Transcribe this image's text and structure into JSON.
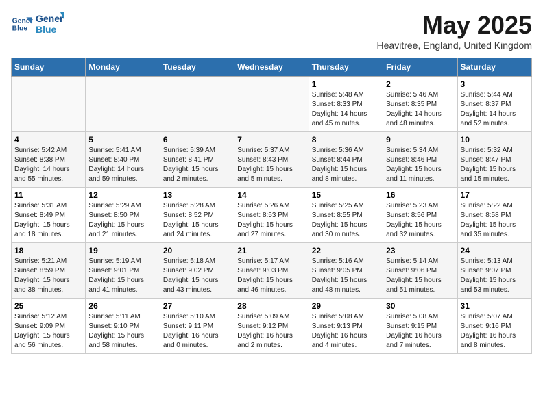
{
  "logo": {
    "line1": "General",
    "line2": "Blue"
  },
  "title": "May 2025",
  "location": "Heavitree, England, United Kingdom",
  "days_header": [
    "Sunday",
    "Monday",
    "Tuesday",
    "Wednesday",
    "Thursday",
    "Friday",
    "Saturday"
  ],
  "weeks": [
    [
      {
        "day": "",
        "sunrise": "",
        "sunset": "",
        "daylight": ""
      },
      {
        "day": "",
        "sunrise": "",
        "sunset": "",
        "daylight": ""
      },
      {
        "day": "",
        "sunrise": "",
        "sunset": "",
        "daylight": ""
      },
      {
        "day": "",
        "sunrise": "",
        "sunset": "",
        "daylight": ""
      },
      {
        "day": "1",
        "sunrise": "Sunrise: 5:48 AM",
        "sunset": "Sunset: 8:33 PM",
        "daylight": "Daylight: 14 hours and 45 minutes."
      },
      {
        "day": "2",
        "sunrise": "Sunrise: 5:46 AM",
        "sunset": "Sunset: 8:35 PM",
        "daylight": "Daylight: 14 hours and 48 minutes."
      },
      {
        "day": "3",
        "sunrise": "Sunrise: 5:44 AM",
        "sunset": "Sunset: 8:37 PM",
        "daylight": "Daylight: 14 hours and 52 minutes."
      }
    ],
    [
      {
        "day": "4",
        "sunrise": "Sunrise: 5:42 AM",
        "sunset": "Sunset: 8:38 PM",
        "daylight": "Daylight: 14 hours and 55 minutes."
      },
      {
        "day": "5",
        "sunrise": "Sunrise: 5:41 AM",
        "sunset": "Sunset: 8:40 PM",
        "daylight": "Daylight: 14 hours and 59 minutes."
      },
      {
        "day": "6",
        "sunrise": "Sunrise: 5:39 AM",
        "sunset": "Sunset: 8:41 PM",
        "daylight": "Daylight: 15 hours and 2 minutes."
      },
      {
        "day": "7",
        "sunrise": "Sunrise: 5:37 AM",
        "sunset": "Sunset: 8:43 PM",
        "daylight": "Daylight: 15 hours and 5 minutes."
      },
      {
        "day": "8",
        "sunrise": "Sunrise: 5:36 AM",
        "sunset": "Sunset: 8:44 PM",
        "daylight": "Daylight: 15 hours and 8 minutes."
      },
      {
        "day": "9",
        "sunrise": "Sunrise: 5:34 AM",
        "sunset": "Sunset: 8:46 PM",
        "daylight": "Daylight: 15 hours and 11 minutes."
      },
      {
        "day": "10",
        "sunrise": "Sunrise: 5:32 AM",
        "sunset": "Sunset: 8:47 PM",
        "daylight": "Daylight: 15 hours and 15 minutes."
      }
    ],
    [
      {
        "day": "11",
        "sunrise": "Sunrise: 5:31 AM",
        "sunset": "Sunset: 8:49 PM",
        "daylight": "Daylight: 15 hours and 18 minutes."
      },
      {
        "day": "12",
        "sunrise": "Sunrise: 5:29 AM",
        "sunset": "Sunset: 8:50 PM",
        "daylight": "Daylight: 15 hours and 21 minutes."
      },
      {
        "day": "13",
        "sunrise": "Sunrise: 5:28 AM",
        "sunset": "Sunset: 8:52 PM",
        "daylight": "Daylight: 15 hours and 24 minutes."
      },
      {
        "day": "14",
        "sunrise": "Sunrise: 5:26 AM",
        "sunset": "Sunset: 8:53 PM",
        "daylight": "Daylight: 15 hours and 27 minutes."
      },
      {
        "day": "15",
        "sunrise": "Sunrise: 5:25 AM",
        "sunset": "Sunset: 8:55 PM",
        "daylight": "Daylight: 15 hours and 30 minutes."
      },
      {
        "day": "16",
        "sunrise": "Sunrise: 5:23 AM",
        "sunset": "Sunset: 8:56 PM",
        "daylight": "Daylight: 15 hours and 32 minutes."
      },
      {
        "day": "17",
        "sunrise": "Sunrise: 5:22 AM",
        "sunset": "Sunset: 8:58 PM",
        "daylight": "Daylight: 15 hours and 35 minutes."
      }
    ],
    [
      {
        "day": "18",
        "sunrise": "Sunrise: 5:21 AM",
        "sunset": "Sunset: 8:59 PM",
        "daylight": "Daylight: 15 hours and 38 minutes."
      },
      {
        "day": "19",
        "sunrise": "Sunrise: 5:19 AM",
        "sunset": "Sunset: 9:01 PM",
        "daylight": "Daylight: 15 hours and 41 minutes."
      },
      {
        "day": "20",
        "sunrise": "Sunrise: 5:18 AM",
        "sunset": "Sunset: 9:02 PM",
        "daylight": "Daylight: 15 hours and 43 minutes."
      },
      {
        "day": "21",
        "sunrise": "Sunrise: 5:17 AM",
        "sunset": "Sunset: 9:03 PM",
        "daylight": "Daylight: 15 hours and 46 minutes."
      },
      {
        "day": "22",
        "sunrise": "Sunrise: 5:16 AM",
        "sunset": "Sunset: 9:05 PM",
        "daylight": "Daylight: 15 hours and 48 minutes."
      },
      {
        "day": "23",
        "sunrise": "Sunrise: 5:14 AM",
        "sunset": "Sunset: 9:06 PM",
        "daylight": "Daylight: 15 hours and 51 minutes."
      },
      {
        "day": "24",
        "sunrise": "Sunrise: 5:13 AM",
        "sunset": "Sunset: 9:07 PM",
        "daylight": "Daylight: 15 hours and 53 minutes."
      }
    ],
    [
      {
        "day": "25",
        "sunrise": "Sunrise: 5:12 AM",
        "sunset": "Sunset: 9:09 PM",
        "daylight": "Daylight: 15 hours and 56 minutes."
      },
      {
        "day": "26",
        "sunrise": "Sunrise: 5:11 AM",
        "sunset": "Sunset: 9:10 PM",
        "daylight": "Daylight: 15 hours and 58 minutes."
      },
      {
        "day": "27",
        "sunrise": "Sunrise: 5:10 AM",
        "sunset": "Sunset: 9:11 PM",
        "daylight": "Daylight: 16 hours and 0 minutes."
      },
      {
        "day": "28",
        "sunrise": "Sunrise: 5:09 AM",
        "sunset": "Sunset: 9:12 PM",
        "daylight": "Daylight: 16 hours and 2 minutes."
      },
      {
        "day": "29",
        "sunrise": "Sunrise: 5:08 AM",
        "sunset": "Sunset: 9:13 PM",
        "daylight": "Daylight: 16 hours and 4 minutes."
      },
      {
        "day": "30",
        "sunrise": "Sunrise: 5:08 AM",
        "sunset": "Sunset: 9:15 PM",
        "daylight": "Daylight: 16 hours and 7 minutes."
      },
      {
        "day": "31",
        "sunrise": "Sunrise: 5:07 AM",
        "sunset": "Sunset: 9:16 PM",
        "daylight": "Daylight: 16 hours and 8 minutes."
      }
    ]
  ]
}
